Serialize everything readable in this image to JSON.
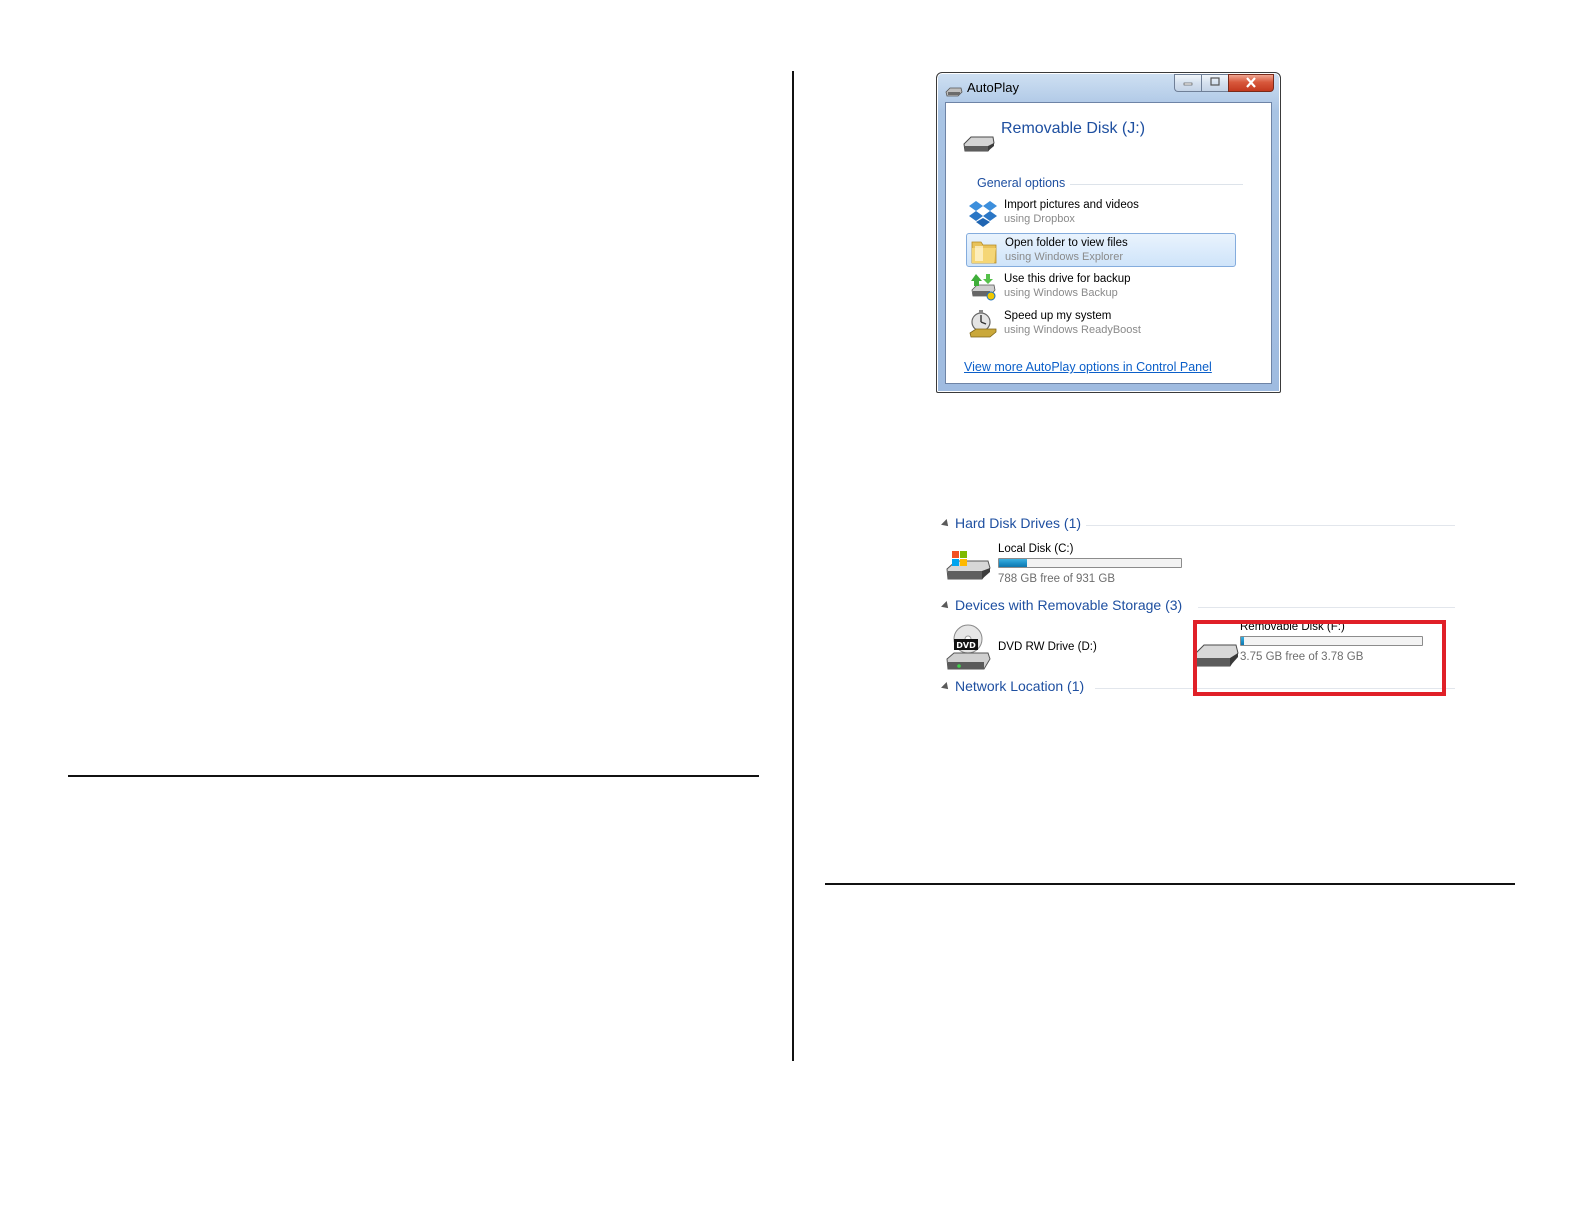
{
  "autoplay_window": {
    "title": "AutoPlay",
    "device_title": "Removable Disk (J:)",
    "group_label": "General options",
    "options": [
      {
        "title": "Import pictures and videos",
        "subtitle": "using Dropbox",
        "icon": "dropbox-icon",
        "selected": false
      },
      {
        "title": "Open folder to view files",
        "subtitle": "using Windows Explorer",
        "icon": "folder-icon",
        "selected": true
      },
      {
        "title": "Use this drive for backup",
        "subtitle": "using Windows Backup",
        "icon": "backup-icon",
        "selected": false
      },
      {
        "title": "Speed up my system",
        "subtitle": "using Windows ReadyBoost",
        "icon": "readyboost-icon",
        "selected": false
      }
    ],
    "more_link": "View more AutoPlay options in Control Panel"
  },
  "drives_panel": {
    "sections": [
      {
        "label": "Hard Disk Drives (1)"
      },
      {
        "label": "Devices with Removable Storage (3)"
      },
      {
        "label": "Network Location (1)"
      }
    ],
    "local_disk": {
      "name": "Local Disk (C:)",
      "free_text": "788 GB free of 931 GB",
      "used_fraction": 0.154
    },
    "dvd_drive": {
      "name": "DVD RW Drive (D:)",
      "icon_label": "DVD"
    },
    "removable_disk": {
      "name": "Removable Disk (F:)",
      "free_text": "3.75 GB free of 3.78 GB",
      "used_fraction": 0.008
    }
  },
  "colors": {
    "heading_blue": "#1e4fa0",
    "link_blue": "#0b5fc9",
    "highlight_red": "#e02028",
    "bar_fill": "#1c8fc7"
  }
}
